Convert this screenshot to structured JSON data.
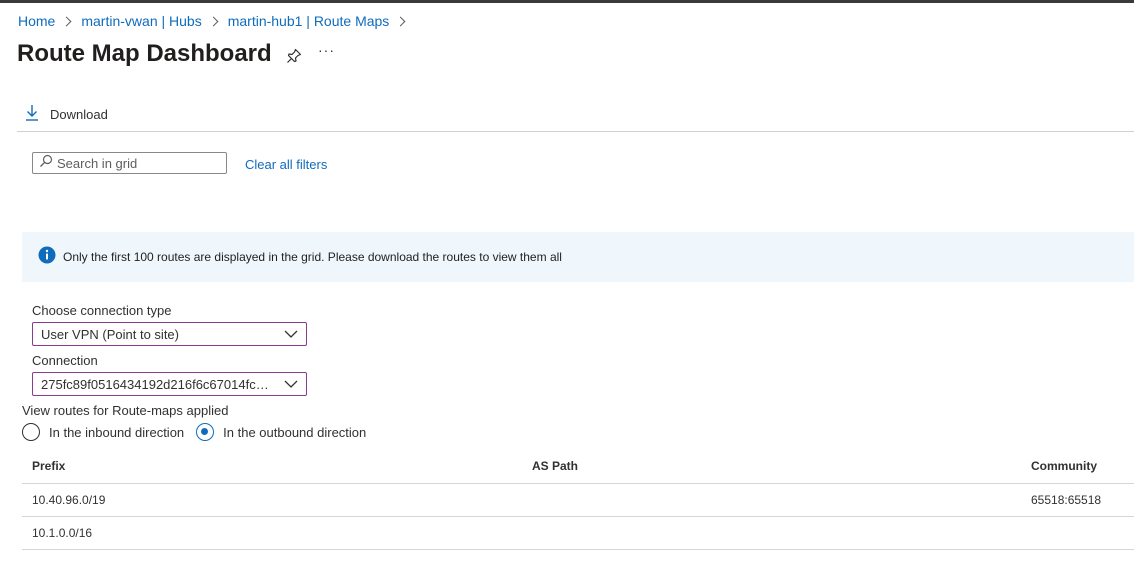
{
  "breadcrumb": [
    {
      "label": "Home"
    },
    {
      "label": "martin-vwan | Hubs"
    },
    {
      "label": "martin-hub1 | Route Maps"
    }
  ],
  "page": {
    "title": "Route Map Dashboard",
    "more_label": "···"
  },
  "toolbar": {
    "download_label": "Download"
  },
  "filter": {
    "search_placeholder": "Search in grid",
    "clear_label": "Clear all filters"
  },
  "banner": {
    "message": "Only the first 100 routes are displayed in the grid. Please download the routes to view them all"
  },
  "form": {
    "connection_type_label": "Choose connection type",
    "connection_type_value": "User VPN (Point to site)",
    "connection_label": "Connection",
    "connection_value": "275fc89f0516434192d216f6c67014fc-c...",
    "direction_label": "View routes for Route-maps applied",
    "inbound_label": "In the inbound direction",
    "outbound_label": "In the outbound direction",
    "selected_direction": "outbound"
  },
  "grid": {
    "columns": [
      "Prefix",
      "AS Path",
      "Community"
    ],
    "rows": [
      {
        "prefix": "10.40.96.0/19",
        "as_path": "",
        "community": "65518:65518"
      },
      {
        "prefix": "10.1.0.0/16",
        "as_path": "",
        "community": ""
      }
    ]
  },
  "colors": {
    "link": "#0f6cbd",
    "banner_bg": "#eff6fc",
    "dropdown_border": "#8a3a8f",
    "info_icon": "#0f6cbd"
  },
  "icons": [
    "pin-icon",
    "download-icon",
    "search-icon",
    "info-icon",
    "chevron-down-icon"
  ]
}
